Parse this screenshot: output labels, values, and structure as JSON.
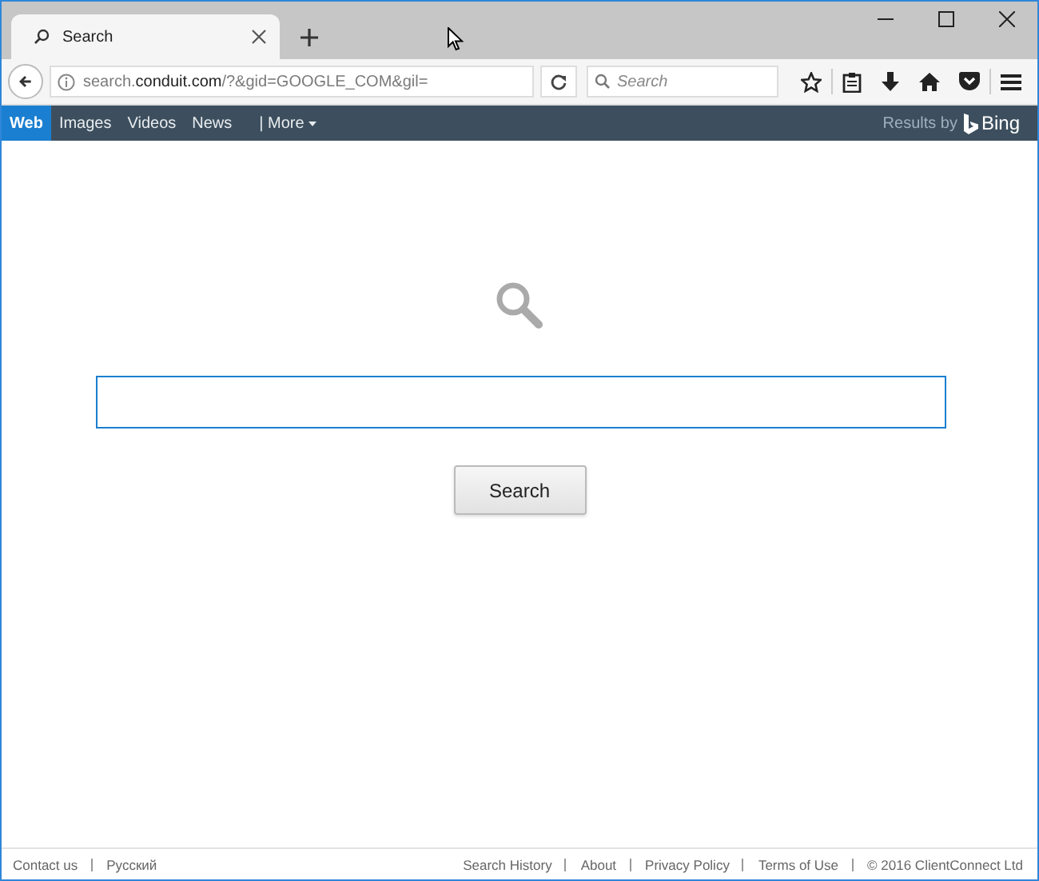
{
  "tab": {
    "title": "Search",
    "selected": true
  },
  "url": "search.**conduit.com**/?&gid=GOOGLE_COM&gil=",
  "search_box": {
    "placeholder": "Search"
  },
  "nav": {
    "items": [
      {
        "label": "Web",
        "selected": true,
        "kind": "link"
      },
      {
        "label": "Images",
        "selected": false,
        "kind": "link"
      },
      {
        "label": "Videos",
        "selected": false,
        "kind": "link"
      },
      {
        "label": "News",
        "selected": false,
        "kind": "link"
      },
      {
        "label": "| More",
        "selected": false,
        "kind": "dropdown"
      }
    ],
    "results_by": "Results by",
    "brand": "Bing"
  },
  "search_button": "Search",
  "footer": {
    "left": [
      "Contact us",
      "Русский"
    ],
    "right": [
      "Search History",
      "About",
      "Privacy Policy",
      "Terms of Use",
      "© 2016 ClientConnect Ltd"
    ]
  }
}
